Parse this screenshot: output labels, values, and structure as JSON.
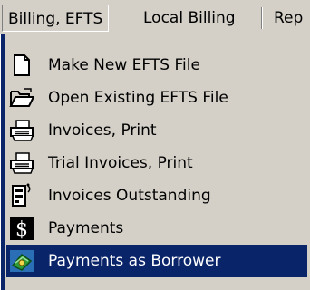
{
  "menubar": {
    "items": [
      {
        "label": "Billing, EFTS"
      },
      {
        "label": "Local Billing"
      },
      {
        "label": "Rep"
      }
    ]
  },
  "menu": {
    "items": [
      {
        "label": "Make New EFTS File",
        "icon": "new-file-icon"
      },
      {
        "label": "Open Existing EFTS File",
        "icon": "open-folder-icon"
      },
      {
        "label": "Invoices, Print",
        "icon": "printer-icon"
      },
      {
        "label": "Trial Invoices, Print",
        "icon": "printer-icon"
      },
      {
        "label": "Invoices Outstanding",
        "icon": "document-list-icon"
      },
      {
        "label": "Payments",
        "icon": "dollar-icon"
      },
      {
        "label": "Payments as Borrower",
        "icon": "money-stack-icon"
      }
    ]
  },
  "colors": {
    "menu_bg": "#d4d0c8",
    "highlight": "#0a246a",
    "highlight_text": "#ffffff"
  }
}
